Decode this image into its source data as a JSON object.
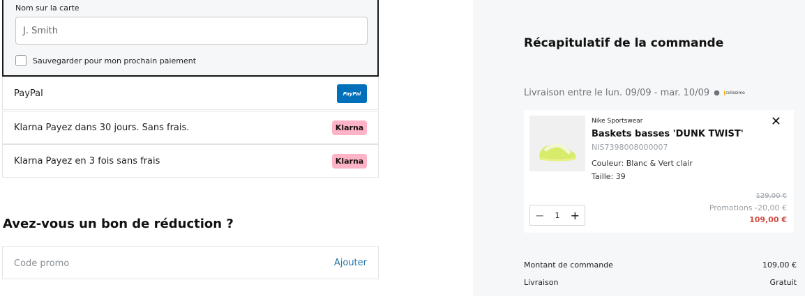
{
  "payment": {
    "card": {
      "name_label": "Nom sur la carte",
      "name_placeholder": "J. Smith",
      "save_label": "Sauvegarder pour mon prochain paiement"
    },
    "methods": [
      {
        "label": "PayPal",
        "badge": "PayPal",
        "badge_color": "#0070ba"
      },
      {
        "label": "Klarna Payez dans 30 jours. Sans frais.",
        "badge": "Klarna",
        "badge_color": "#ffb3c7"
      },
      {
        "label": "Klarna Payez en 3 fois sans frais",
        "badge": "Klarna",
        "badge_color": "#ffb3c7"
      }
    ]
  },
  "promo": {
    "title": "Avez-vous un bon de réduction ?",
    "placeholder": "Code promo",
    "add_label": "Ajouter"
  },
  "summary": {
    "title": "Récapitulatif de la commande",
    "delivery": "Livraison entre le lun. 09/09 - mar. 10/09",
    "carrier_logo": "colissimo",
    "item": {
      "brand": "Nike Sportswear",
      "name": "Baskets basses 'DUNK TWIST'",
      "sku": "NIS7398008000007",
      "color": "Couleur: Blanc & Vert clair",
      "size": "Taille: 39",
      "quantity": "1",
      "old_price": "129,00 €",
      "promotion": "Promotions -20,00 €",
      "price": "109,00 €",
      "price_color": "#d14b3f"
    },
    "totals": [
      {
        "label": "Montant de commande",
        "value": "109,00 €"
      },
      {
        "label": "Livraison",
        "value": "Gratuit"
      }
    ]
  }
}
